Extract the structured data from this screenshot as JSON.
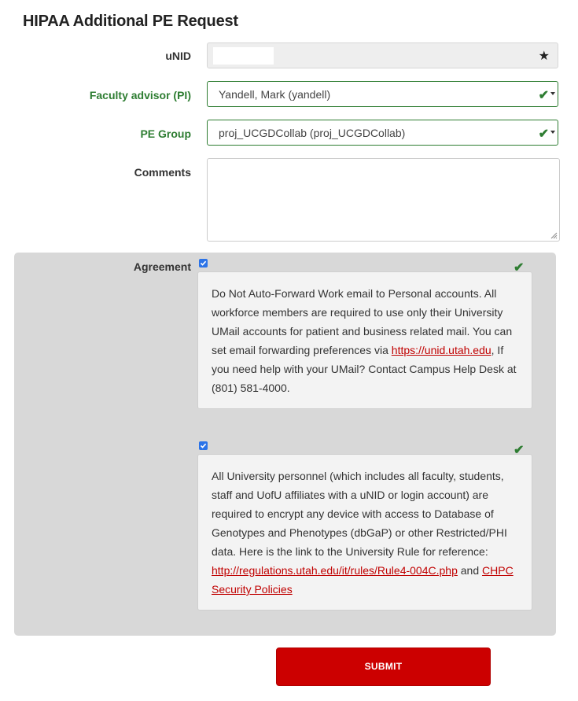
{
  "page_title": "HIPAA Additional PE Request",
  "form": {
    "unid": {
      "label": "uNID",
      "value": "",
      "required_icon": "star-icon"
    },
    "faculty_advisor": {
      "label": "Faculty advisor (PI)",
      "value": "Yandell, Mark (yandell)",
      "valid": true
    },
    "pe_group": {
      "label": "PE Group",
      "value": "proj_UCGDCollab (proj_UCGDCollab)",
      "valid": true
    },
    "comments": {
      "label": "Comments",
      "value": ""
    }
  },
  "agreement": {
    "label": "Agreement",
    "items": [
      {
        "checked": true,
        "text_1": "Do Not Auto-Forward Work email to Personal accounts. All workforce members are required to use only their University UMail accounts for patient and business related mail. You can set email forwarding preferences via ",
        "link_1": "https://unid.utah.edu",
        "text_2": ", If you need help with your UMail? Contact Campus Help Desk at (801) 581-4000."
      },
      {
        "checked": true,
        "text_1": "All University personnel (which includes all faculty, students, staff and UofU affiliates with a uNID or login account) are required to encrypt any device with access to Database of Genotypes and Phenotypes (dbGaP) or other Restricted/PHI data. Here is the link to the University Rule for reference: ",
        "link_1": "http://regulations.utah.edu/it/rules/Rule4-004C.php",
        "text_2": " and ",
        "link_2": "CHPC Security Policies"
      }
    ]
  },
  "submit_label": "SUBMIT",
  "colors": {
    "valid_green": "#2e7d32",
    "brand_red": "#cc0000",
    "link_red": "#c00000",
    "checkbox_blue": "#2b73e8"
  }
}
